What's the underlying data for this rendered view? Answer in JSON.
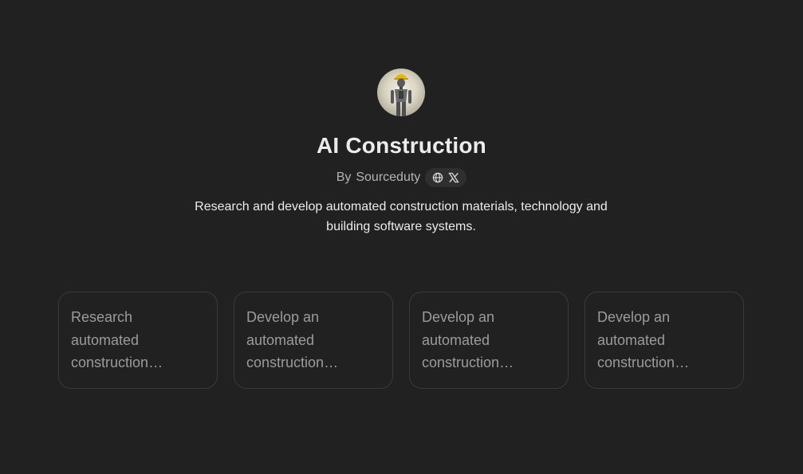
{
  "gpt": {
    "title": "AI Construction",
    "author_prefix": "By",
    "author": "Sourceduty",
    "description": "Research and develop automated construction materials, technology and building software systems."
  },
  "icons": {
    "avatar": "robot-with-hard-hat-avatar",
    "website": "globe-icon",
    "x": "x-logo-icon"
  },
  "starters": [
    {
      "text": "Research automated construction materials"
    },
    {
      "text": "Develop an automated construction system"
    },
    {
      "text": "Develop an automated construction robot"
    },
    {
      "text": "Develop an automated construction software"
    }
  ],
  "colors": {
    "background": "#212121",
    "text": "#ececec",
    "muted": "#b4b4b4",
    "card_border": "#3a3a3a",
    "hardhat": "#e8b800"
  }
}
